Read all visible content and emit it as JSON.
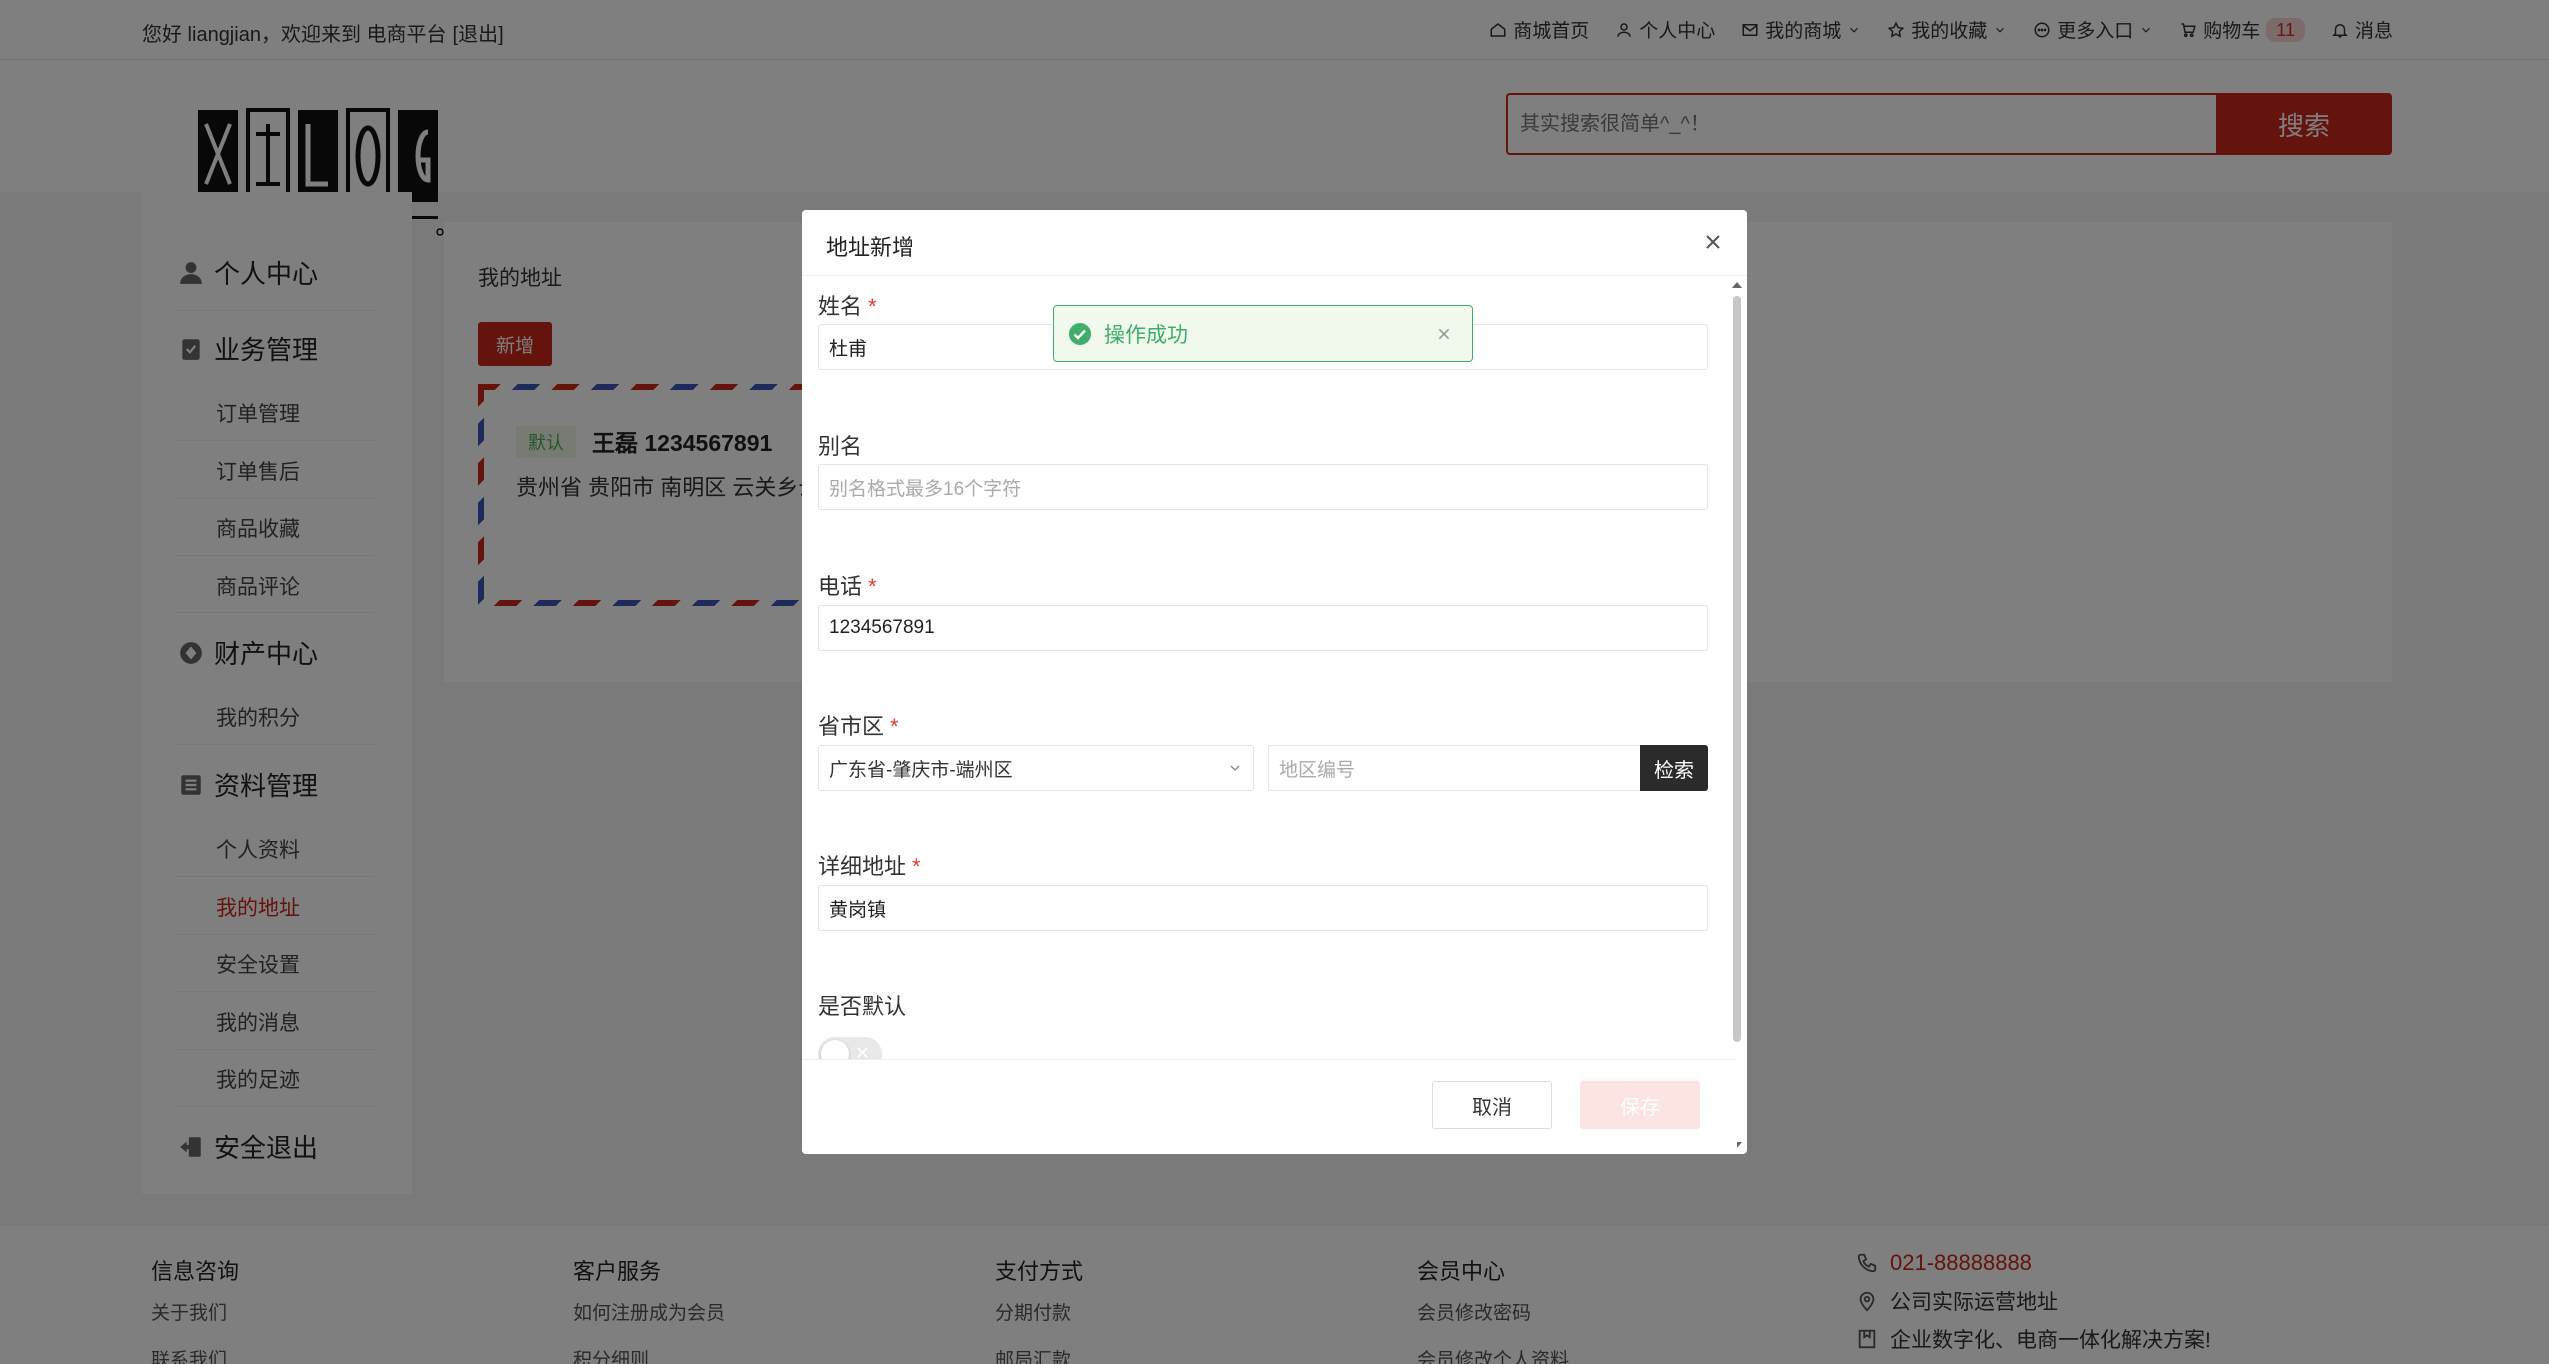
{
  "topbar": {
    "greeting": "您好 liangjian，欢迎来到 电商平台",
    "logout": "[退出]",
    "nav": {
      "home": "商城首页",
      "user_center": "个人中心",
      "my_mall": "我的商城",
      "my_fav": "我的收藏",
      "more": "更多入口",
      "cart": "购物车",
      "cart_count": "11",
      "message": "消息"
    }
  },
  "search": {
    "placeholder": "其实搜索很简单^_^！",
    "button": "搜索"
  },
  "sidebar": {
    "user_center": "个人中心",
    "business": "业务管理",
    "business_items": [
      "订单管理",
      "订单售后",
      "商品收藏",
      "商品评论"
    ],
    "finance": "财产中心",
    "finance_items": [
      "我的积分"
    ],
    "profile": "资料管理",
    "profile_items": [
      "个人资料",
      "我的地址",
      "安全设置",
      "我的消息",
      "我的足迹"
    ],
    "logout": "安全退出"
  },
  "main": {
    "title": "我的地址",
    "add_button": "新增",
    "address_card": {
      "tag": "默认",
      "name_phone": "王磊 1234567891",
      "location": "贵州省 贵阳市 南明区 云关乡云"
    }
  },
  "modal": {
    "title": "地址新增",
    "name_label": "姓名",
    "name_value": "杜甫",
    "alias_label": "别名",
    "alias_placeholder": "别名格式最多16个字符",
    "phone_label": "电话",
    "phone_value": "1234567891",
    "region_label": "省市区",
    "region_value": "广东省-肇庆市-端州区",
    "region_code_placeholder": "地区编号",
    "region_search_button": "检索",
    "detail_label": "详细地址",
    "detail_value": "黄岗镇",
    "default_label": "是否默认",
    "cancel_button": "取消",
    "save_button": "保存"
  },
  "toast": {
    "message": "操作成功"
  },
  "footer": {
    "col1": {
      "title": "信息咨询",
      "links": [
        "关于我们",
        "联系我们"
      ]
    },
    "col2": {
      "title": "客户服务",
      "links": [
        "如何注册成为会员",
        "积分细则"
      ]
    },
    "col3": {
      "title": "支付方式",
      "links": [
        "分期付款",
        "邮局汇款"
      ]
    },
    "col4": {
      "title": "会员中心",
      "links": [
        "会员修改密码",
        "会员修改个人资料"
      ]
    },
    "contact": {
      "phone": "021-88888888",
      "address": "公司实际运营地址",
      "slogan": "企业数字化、电商一体化解决方案!"
    }
  },
  "colors": {
    "brand": "#c8261b",
    "success": "#3fae6a"
  }
}
